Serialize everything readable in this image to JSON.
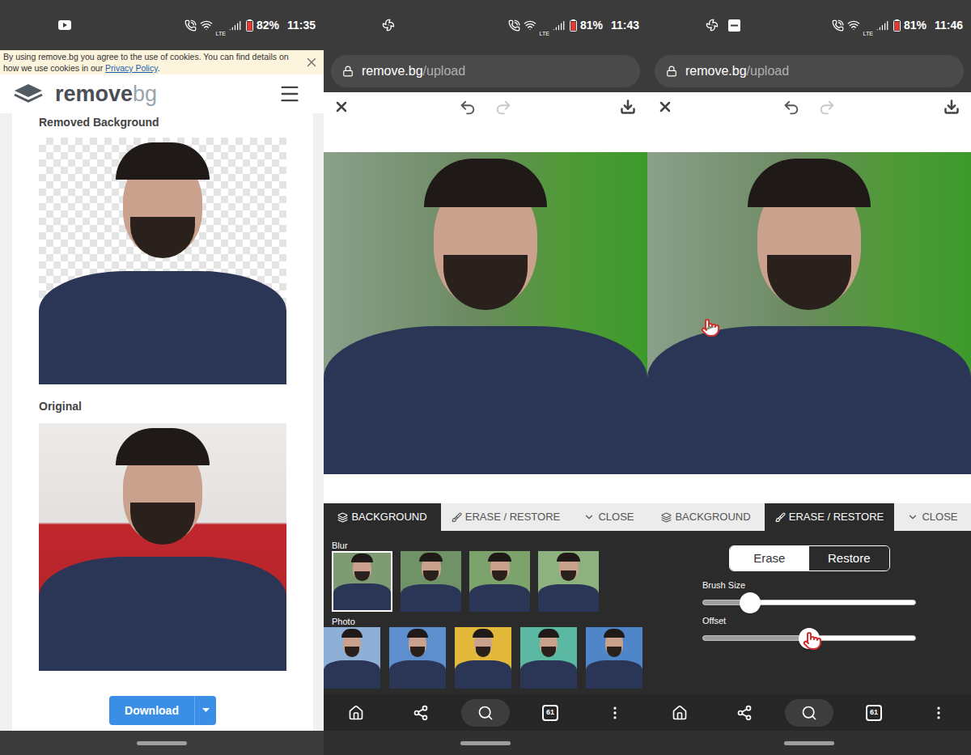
{
  "screens": [
    {
      "kind": "result",
      "status_bar": {
        "notifications": [
          {
            "kind": "youtube"
          }
        ],
        "network": "LTE",
        "battery": "82%",
        "time": "11:35"
      },
      "cookie_banner": {
        "text": "By using remove.bg you agree to the use of cookies. You can find details on how we use cookies in our ",
        "link": "Privacy Policy",
        "end": "."
      },
      "logo": {
        "word": "remove",
        "suffix": "bg"
      },
      "sections": [
        {
          "label": "Removed Background",
          "transparent": true
        },
        {
          "label": "Original",
          "transparent": false
        }
      ],
      "download_button": {
        "label": "Download"
      }
    },
    {
      "kind": "editor",
      "status_bar": {
        "notifications": [
          {
            "kind": "sync"
          }
        ],
        "network": "LTE",
        "battery": "81%",
        "time": "11:43"
      },
      "url": {
        "host": "remove.bg",
        "path": "/upload"
      },
      "toolbar": {
        "undo_enabled": true,
        "redo_enabled": false
      },
      "photo": {
        "cursor": false
      },
      "tabs": [
        {
          "label": "BACKGROUND",
          "selected": true
        },
        {
          "label": "ERASE / RESTORE",
          "selected": false
        },
        {
          "label": "CLOSE",
          "selected": false
        }
      ],
      "panel": {
        "kind": "background",
        "groups": [
          {
            "label": "Blur",
            "thumbnails": [
              {
                "selected": true,
                "color": "#7e9b74"
              },
              {
                "selected": false,
                "color": "#6f9366"
              },
              {
                "selected": false,
                "color": "#7da36d"
              },
              {
                "selected": false,
                "color": "#8db17f"
              }
            ]
          },
          {
            "label": "Photo",
            "thumbnails": [
              {
                "selected": false,
                "color": "#8fb0d6"
              },
              {
                "selected": false,
                "color": "#5d8fcf"
              },
              {
                "selected": false,
                "color": "#e2b93b"
              },
              {
                "selected": false,
                "color": "#5bb8a3"
              },
              {
                "selected": false,
                "color": "#4f86c9"
              }
            ]
          }
        ]
      },
      "tab_count": "61"
    },
    {
      "kind": "editor",
      "status_bar": {
        "notifications": [
          {
            "kind": "sync"
          },
          {
            "kind": "minus"
          }
        ],
        "network": "LTE",
        "battery": "81%",
        "time": "11:46"
      },
      "url": {
        "host": "remove.bg",
        "path": "/upload"
      },
      "toolbar": {
        "undo_enabled": true,
        "redo_enabled": false
      },
      "photo": {
        "cursor": true
      },
      "tabs": [
        {
          "label": "BACKGROUND",
          "selected": false
        },
        {
          "label": "ERASE / RESTORE",
          "selected": true
        },
        {
          "label": "CLOSE",
          "selected": false
        }
      ],
      "panel": {
        "kind": "erase_restore",
        "modes": [
          {
            "label": "Erase",
            "selected": true
          },
          {
            "label": "Restore",
            "selected": false
          }
        ],
        "sliders": [
          {
            "label": "Brush Size",
            "level": 0.22,
            "cursor": false
          },
          {
            "label": "Offset",
            "level": 0.5,
            "cursor": true
          }
        ]
      },
      "tab_count": "61"
    }
  ]
}
